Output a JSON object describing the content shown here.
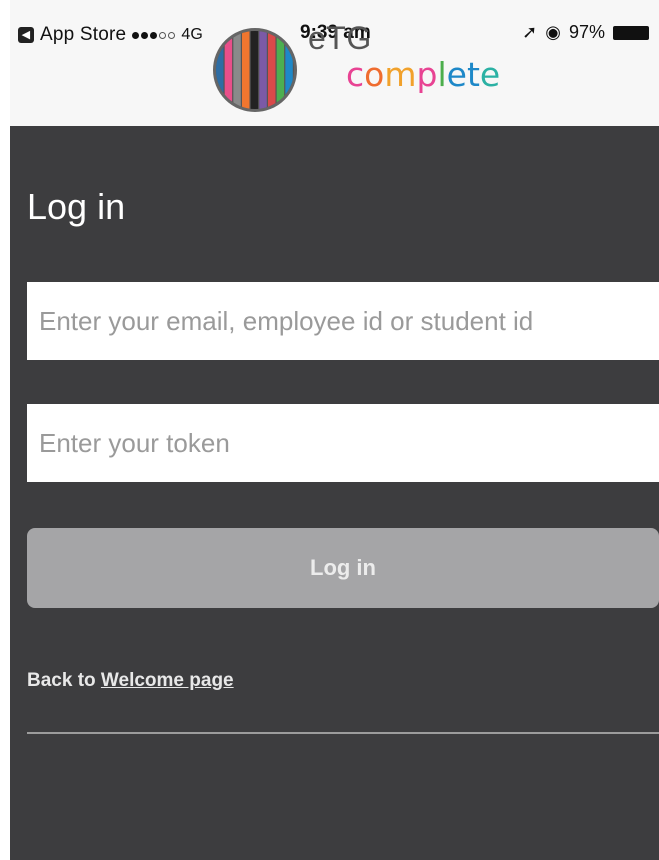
{
  "status_bar": {
    "back_app": "App Store",
    "network": "4G",
    "time": "9:39 am",
    "battery": "97%"
  },
  "logo": {
    "top_text": "eTG",
    "bottom_text": "complete",
    "stripe_colors": [
      "#2e6da4",
      "#e94f8a",
      "#8a8a8a",
      "#f0762f",
      "#222222",
      "#7b5aa6",
      "#d94a4a",
      "#4caf50",
      "#1e88c8"
    ],
    "letter_colors": [
      "#e84393",
      "#ef6c2f",
      "#f1a12b",
      "#e84393",
      "#4cae4c",
      "#1e88c8",
      "#1e88c8",
      "#2bb1a4"
    ]
  },
  "main": {
    "title": "Log in",
    "email_placeholder": "Enter your email, employee id or student id",
    "token_placeholder": "Enter your token",
    "login_label": "Log in",
    "back_prefix": "Back to ",
    "back_link": "Welcome page"
  }
}
